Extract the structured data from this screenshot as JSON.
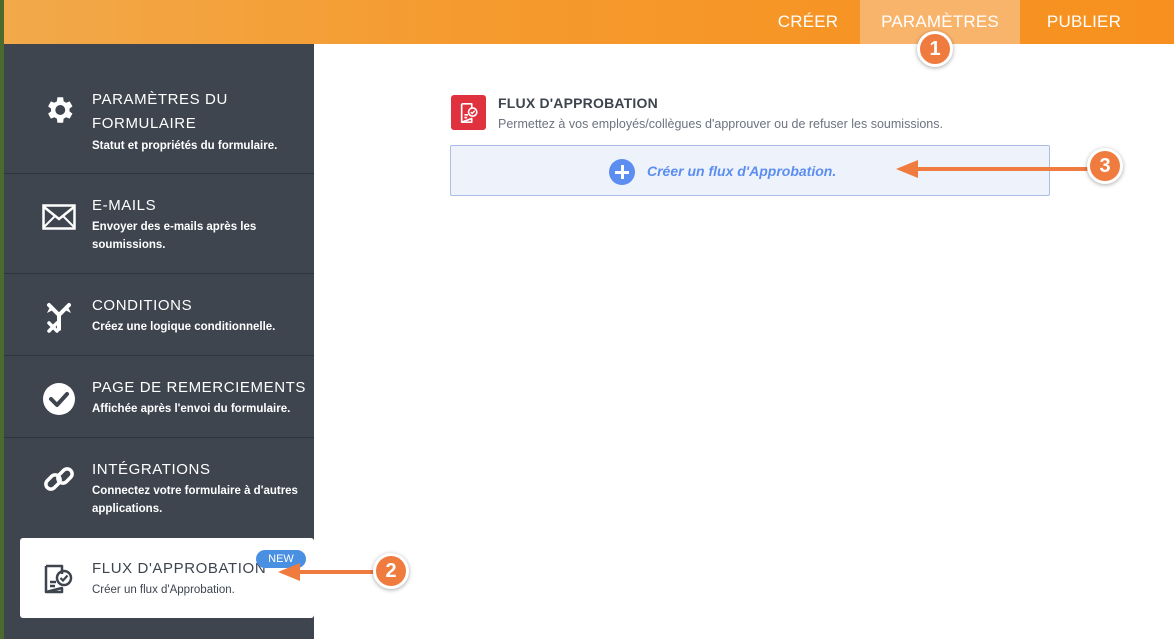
{
  "topbar": {
    "tabs": [
      {
        "label": "CRÉER"
      },
      {
        "label": "PARAMÈTRES",
        "active": true
      },
      {
        "label": "PUBLIER"
      }
    ]
  },
  "sidebar": {
    "items": [
      {
        "title": "PARAMÈTRES DU FORMULAIRE",
        "desc": "Statut et propriétés du formulaire.",
        "icon": "gear-icon"
      },
      {
        "title": "E-MAILS",
        "desc": "Envoyer des e-mails après les soumissions.",
        "icon": "envelope-icon"
      },
      {
        "title": "CONDITIONS",
        "desc": "Créez une logique conditionnelle.",
        "icon": "conditions-icon"
      },
      {
        "title": "PAGE DE REMERCIEMENTS",
        "desc": "Affichée après l'envoi du formulaire.",
        "icon": "check-circle-icon"
      },
      {
        "title": "INTÉGRATIONS",
        "desc": "Connectez votre formulaire à d'autres applications.",
        "icon": "link-icon"
      },
      {
        "title": "FLUX D'APPROBATION",
        "desc": "Créer un flux d'Approbation.",
        "icon": "approval-icon",
        "badge": "NEW",
        "active": true
      }
    ]
  },
  "main": {
    "section_title": "FLUX D'APPROBATION",
    "section_subtitle": "Permettez à vos employés/collègues d'approuver ou de refuser les soumissions.",
    "create_button_label": "Créer un flux d'Approbation."
  },
  "annotations": [
    "1",
    "2",
    "3"
  ],
  "colors": {
    "topbar": "#f7901e",
    "sidebar": "#3e454f",
    "accent_blue": "#5b8ef0",
    "marker": "#f07b3e",
    "approval_red": "#e0313f"
  }
}
